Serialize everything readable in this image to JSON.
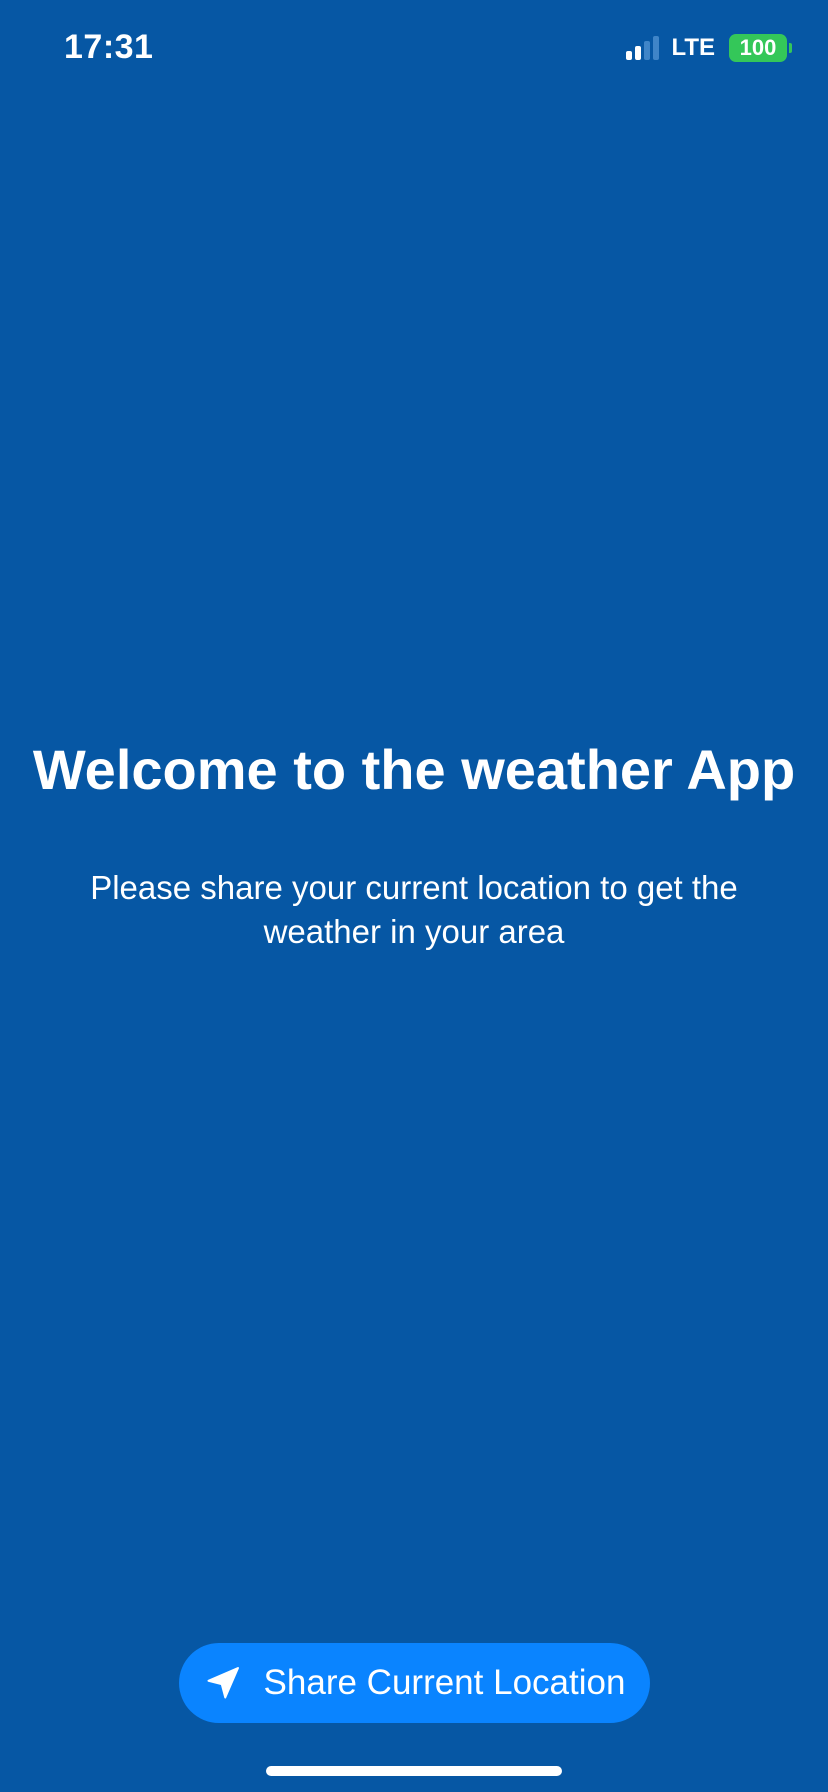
{
  "status_bar": {
    "time": "17:31",
    "network": "LTE",
    "battery": "100",
    "icons": {
      "signal": "cellular-signal-icon",
      "battery": "battery-icon"
    }
  },
  "welcome": {
    "title": "Welcome to the weather App",
    "subtitle": "Please share your current location to get the weather in your area"
  },
  "share_button": {
    "label": "Share Current Location",
    "icon": "location-arrow-icon"
  },
  "colors": {
    "background": "#0657A4",
    "button": "#0A84FF",
    "battery": "#34C759",
    "text": "#FFFFFF"
  }
}
